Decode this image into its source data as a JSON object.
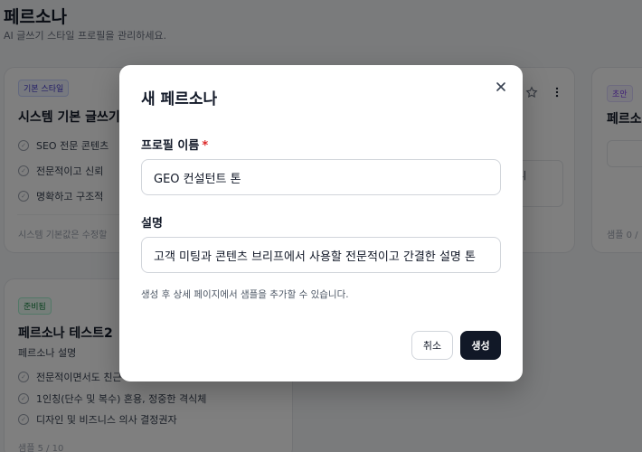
{
  "page": {
    "title": "페르소나",
    "subtitle": "AI 글쓰기 스타일 프로필을 관리하세요."
  },
  "cards": [
    {
      "badge": "기본 스타일",
      "title": "시스템 기본 글쓰기",
      "traits": [
        "SEO 전문 콘텐츠",
        "전문적이고 신뢰",
        "명확하고 구조적"
      ],
      "footer": "시스템 기본값은 수정할"
    },
    {
      "badge": "준비됨",
      "title": "페르소나 테스트2",
      "description": "페르소나 설명",
      "traits": [
        "전문적이면서도 친근",
        "1인칭(단수 및 복수) 혼용, 정중한 격식체",
        "디자인 및 비즈니스 의사 결정권자"
      ],
      "footer": "샘플 5 / 10"
    },
    {
      "snippet": "됩니"
    },
    {
      "badge": "초안",
      "title": "페르소",
      "footer": "샘플 0 /"
    }
  ],
  "modal": {
    "title": "새 페르소나",
    "close_icon": "close-icon",
    "name_label": "프로필 이름",
    "required_mark": "*",
    "name_value": "GEO 컨설턴트 톤",
    "desc_label": "설명",
    "desc_value": "고객 미팅과 콘텐츠 브리프에서 사용할 전문적이고 간결한 설명 톤",
    "hint": "생성 후 상세 페이지에서 샘플을 추가할 수 있습니다.",
    "cancel_label": "취소",
    "create_label": "생성"
  },
  "colors": {
    "primary_button": "#111827",
    "required": "#dc2626",
    "overlay": "rgba(0,0,0,0.5)"
  }
}
